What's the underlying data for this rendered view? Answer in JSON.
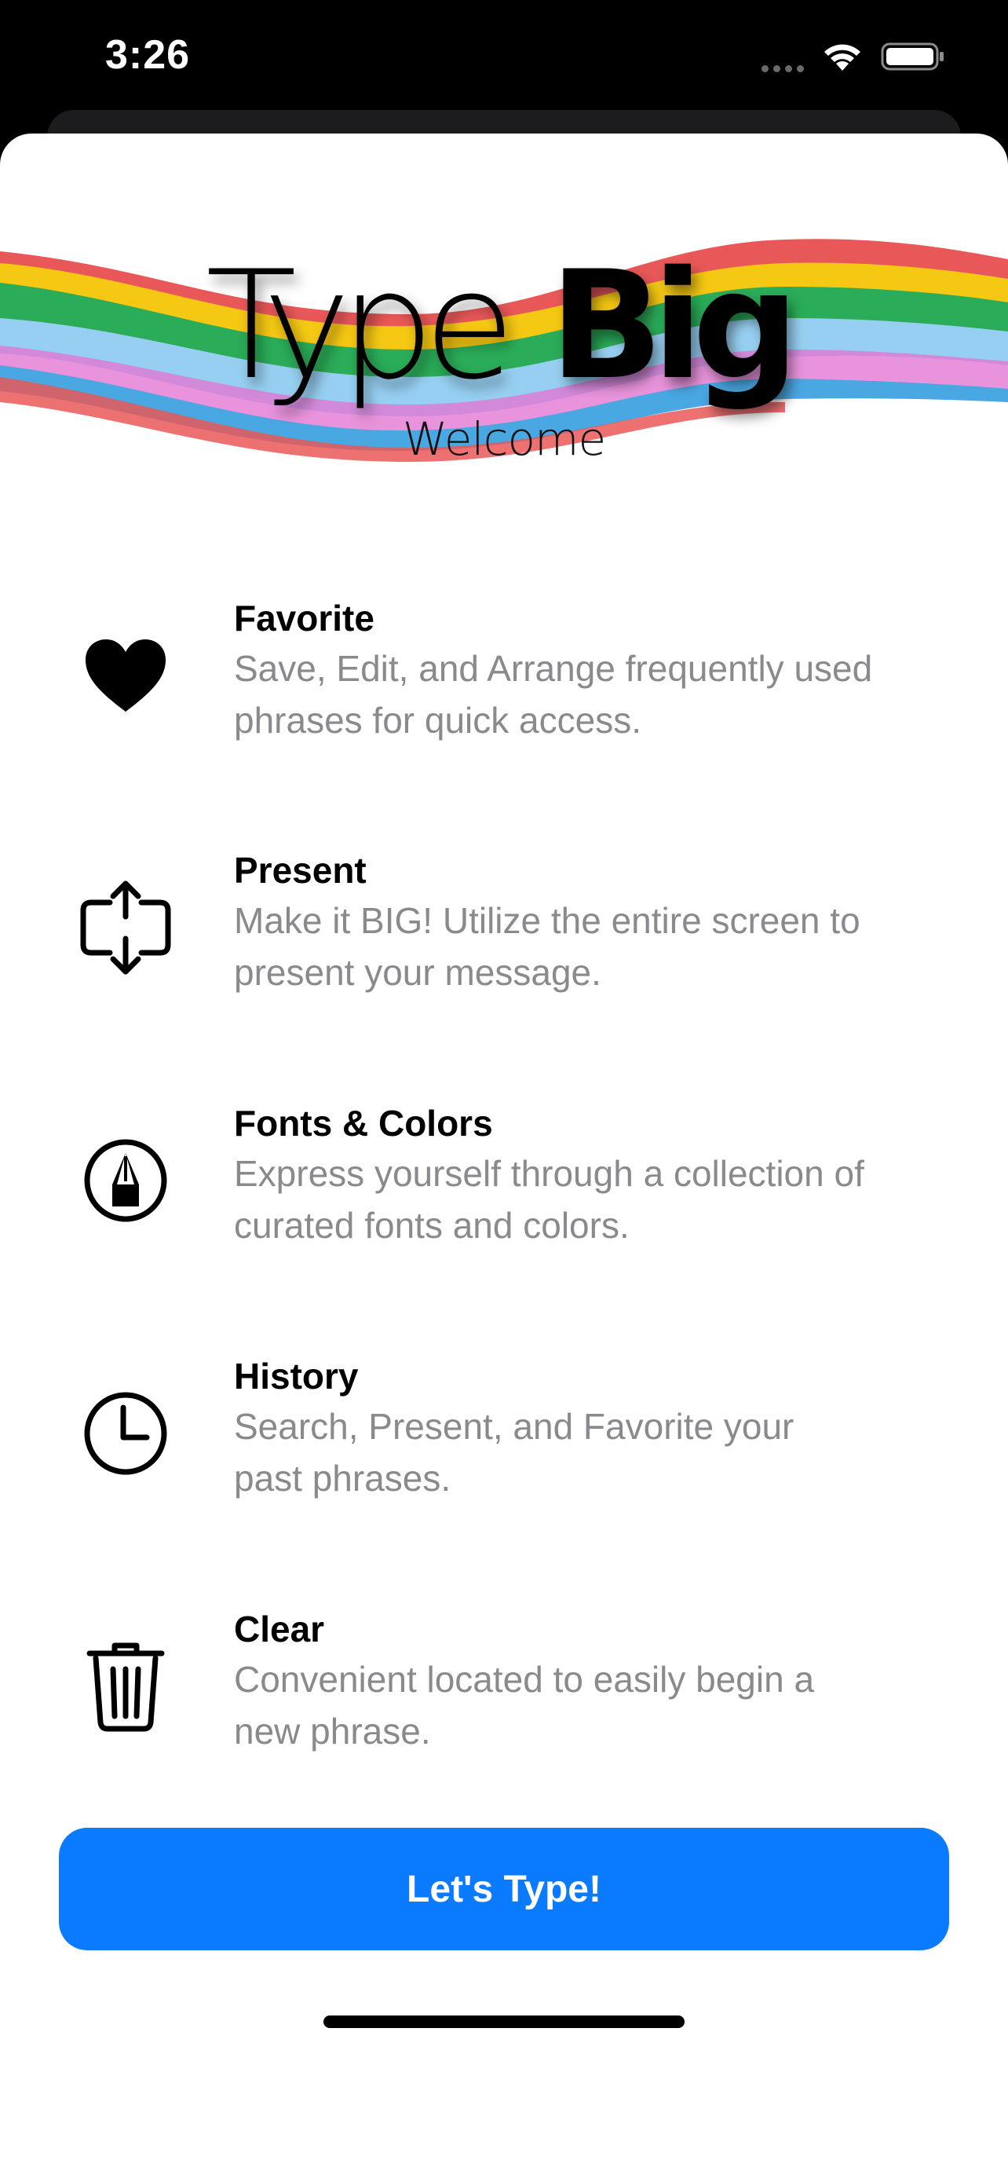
{
  "status_bar": {
    "time": "3:26",
    "icons": [
      "signal-dots-icon",
      "wifi-icon",
      "battery-icon"
    ]
  },
  "header": {
    "logo_text_light": "Type",
    "logo_text_bold": "Big",
    "subtitle": "Welcome"
  },
  "features": [
    {
      "icon": "heart-icon",
      "title": "Favorite",
      "description_line1": "Save, Edit, and Arrange frequently used",
      "description_line2": "phrases for quick access."
    },
    {
      "icon": "fullscreen-arrows-icon",
      "title": "Present",
      "description_line1": "Make it BIG! Utilize the entire screen to",
      "description_line2": "present your message."
    },
    {
      "icon": "pen-tip-circle-icon",
      "title": "Fonts & Colors",
      "description_line1": "Express yourself through a collection of",
      "description_line2": "curated fonts and colors."
    },
    {
      "icon": "clock-icon",
      "title": "History",
      "description_line1": "Search, Present, and Favorite your",
      "description_line2": "past phrases."
    },
    {
      "icon": "trash-icon",
      "title": "Clear",
      "description_line1": "Convenient located to easily begin a",
      "description_line2": "new phrase."
    }
  ],
  "cta": {
    "label": "Let's Type!"
  },
  "colors": {
    "accent": "#0a7aff",
    "secondary_text": "#8a8a8e",
    "ribbon": [
      "#f5c400",
      "#19a54a",
      "#3aa0e0",
      "#e06cd0",
      "#e84a4a",
      "#8ecbf0"
    ]
  }
}
